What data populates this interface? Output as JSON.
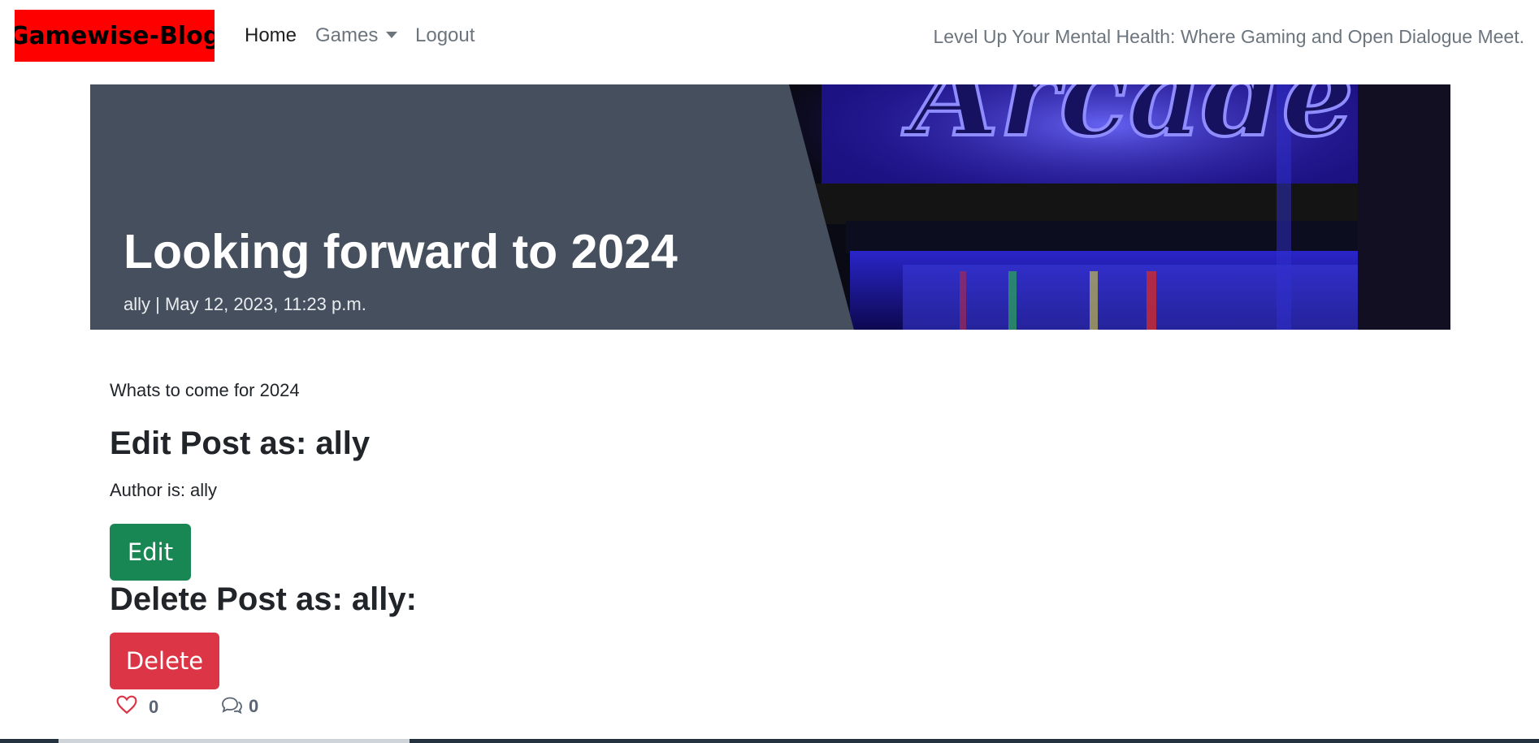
{
  "navbar": {
    "brand": "Gamewise-Blog",
    "links": {
      "home": "Home",
      "games": "Games",
      "logout": "Logout"
    },
    "tagline": "Level Up Your Mental Health: Where Gaming and Open Dialogue Meet."
  },
  "post": {
    "title": "Looking forward to 2024",
    "meta": "ally | May 12, 2023, 11:23 p.m.",
    "excerpt": "Whats to come for 2024",
    "hero_image": "arcade-neon-sign",
    "hero_text": "Arcade"
  },
  "actions": {
    "edit_heading": "Edit Post as: ally",
    "author_line": "Author is: ally",
    "edit_label": "Edit",
    "delete_heading": "Delete Post as: ally:",
    "delete_label": "Delete"
  },
  "stats": {
    "likes": "0",
    "comments": "0",
    "like_icon": "heart-icon",
    "comment_icon": "comments-icon"
  },
  "colors": {
    "brand_bg": "#ff0000",
    "hero_bg": "#454f5d",
    "edit_button": "#198754",
    "delete_button": "#dc3545",
    "heart": "#dc3545",
    "muted_text": "#6c757d"
  }
}
